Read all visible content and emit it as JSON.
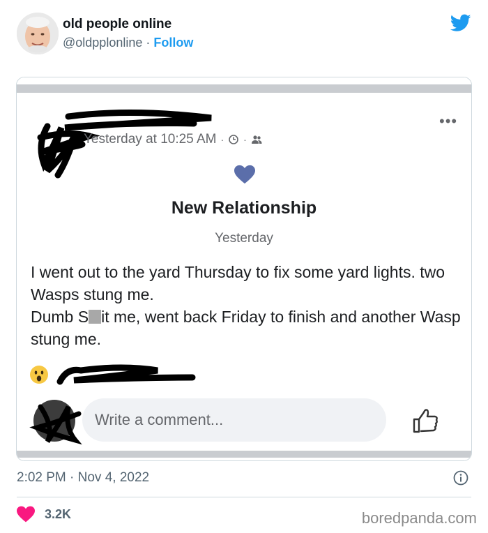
{
  "tweet": {
    "author_name": "old people online",
    "handle": "@oldpplonline",
    "separator": "·",
    "follow_label": "Follow",
    "timestamp": "2:02 PM · Nov 4, 2022",
    "likes_count": "3.2K"
  },
  "fb_post": {
    "meta_time": "Yesterday at 10:25 AM",
    "meta_dot": "·",
    "life_event_title": "New Relationship",
    "life_event_date": "Yesterday",
    "body_line1": "I went out to the yard Thursday to fix some yard lights. two Wasps stung me.",
    "body_line2_before": "Dumb S",
    "body_line2_after": "it me, went back Friday to finish and another Wasp stung me.",
    "comment_placeholder": "Write a comment..."
  },
  "watermark": "boredpanda.com",
  "colors": {
    "twitter_blue": "#1d9bf0",
    "fb_heart": "#5b6eaa",
    "like_heart": "#f91880",
    "secondary_text": "#536471"
  },
  "icons": [
    "twitter-bird-icon",
    "clock-icon",
    "friends-icon",
    "heart-icon",
    "wow-emoji-icon",
    "like-thumb-icon",
    "info-icon",
    "like-heart-icon",
    "more-options-icon"
  ]
}
